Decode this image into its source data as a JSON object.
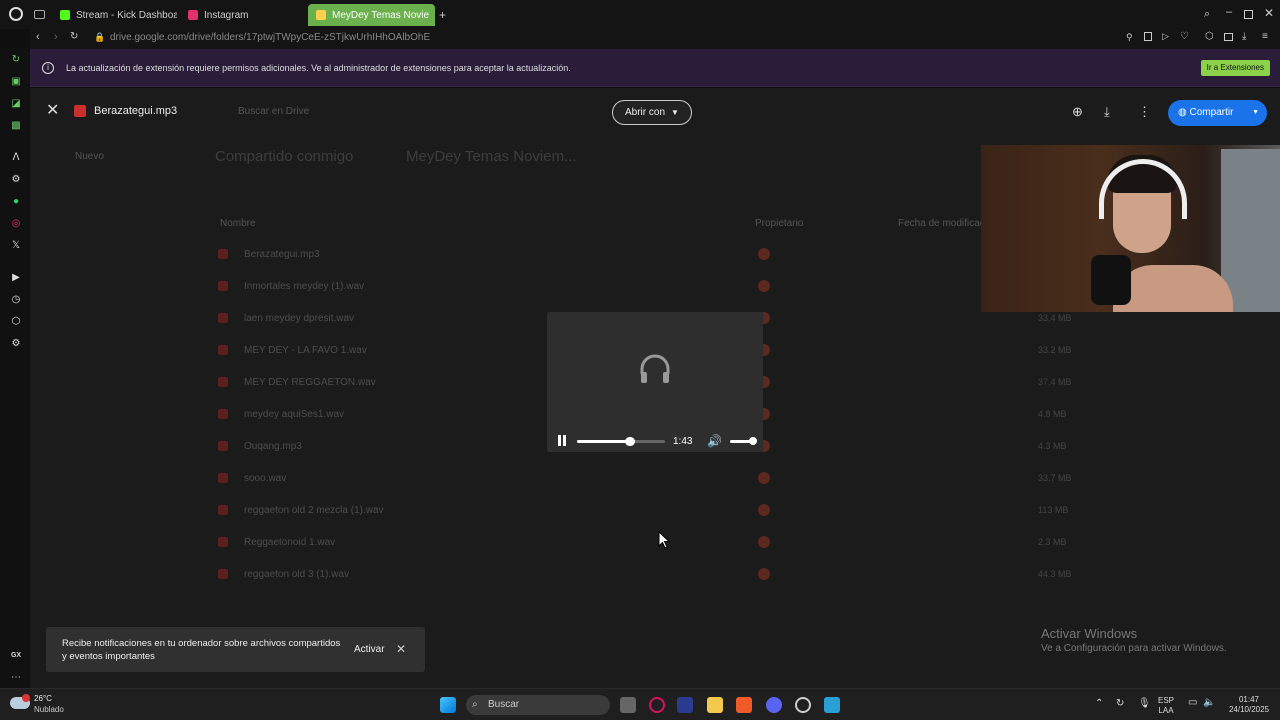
{
  "browser": {
    "tabs": [
      {
        "label": "Stream - Kick Dashboard",
        "color": "#53fc18"
      },
      {
        "label": "Instagram",
        "color": "#e1306c"
      },
      {
        "label": "MeyDey Temas Novie",
        "color": "#1a73e8",
        "active": true
      }
    ],
    "url": "drive.google.com/drive/folders/17ptwjTWpyCeE-zSTjkwUrhIHhOAlbOhE"
  },
  "banner": {
    "message": "La actualización de extensión requiere permisos adicionales. Ve al administrador de extensiones para aceptar la actualización.",
    "button": "Ir a Extensiones"
  },
  "viewer": {
    "file_name": "Berazategui.mp3",
    "open_with": "Abrir con",
    "share": "Compartir"
  },
  "drive_bg": {
    "search_placeholder": "Buscar en Drive",
    "new": "Nuevo",
    "breadcrumb_root": "Compartido conmigo",
    "breadcrumb_folder": "MeyDey Temas Noviem...",
    "col_name": "Nombre",
    "col_owner": "Propietario",
    "col_date": "Fecha de modificac...",
    "files": [
      "Berazategui.mp3",
      "Inmortales meydey (1).wav",
      "laen meydey dpresit.wav",
      "MEY DEY - LA FAVO 1.wav",
      "MEY DEY REGGAETON.wav",
      "meydey aquiSes1.wav",
      "Ouqang.mp3",
      "sooo.wav",
      "reggaeton old 2 mezcla (1).wav",
      "Reggaetonoid 1.wav",
      "reggaeton old 3 (1).wav"
    ],
    "sizes": [
      "",
      "",
      "33.4 MB",
      "33.2 MB",
      "37.4 MB",
      "4.8 MB",
      "4.3 MB",
      "33.7 MB",
      "113 MB",
      "2.3 MB",
      "44.3 MB"
    ]
  },
  "player": {
    "time": "1:43",
    "progress": 0.6,
    "volume": 1.0
  },
  "toast": {
    "text": "Recibe notificaciones en tu ordenador sobre archivos compartidos y eventos importantes",
    "action": "Activar"
  },
  "watermark": {
    "line1": "Activar Windows",
    "line2": "Ve a Configuración para activar Windows."
  },
  "taskbar": {
    "weather_temp": "26°C",
    "weather_desc": "Nublado",
    "search": "Buscar",
    "lang1": "ESP",
    "lang2": "LAA",
    "time": "01:47",
    "date": "24/10/2025"
  }
}
